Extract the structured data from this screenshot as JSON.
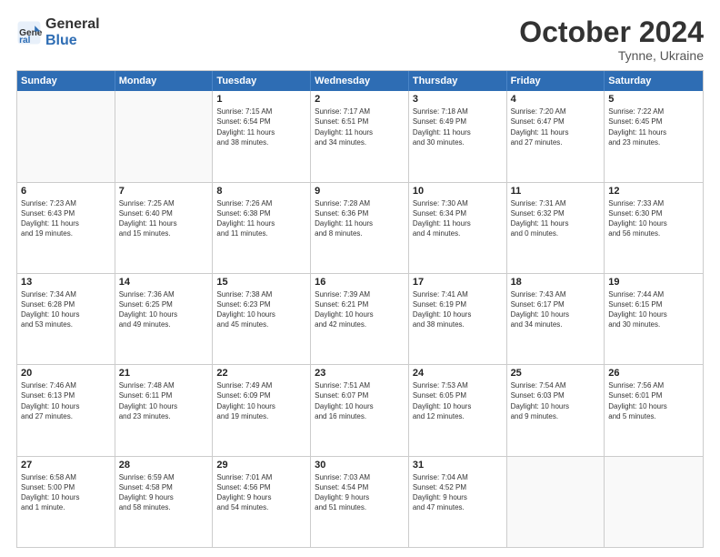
{
  "header": {
    "logo_general": "General",
    "logo_blue": "Blue",
    "month_title": "October 2024",
    "subtitle": "Tynne, Ukraine"
  },
  "weekdays": [
    "Sunday",
    "Monday",
    "Tuesday",
    "Wednesday",
    "Thursday",
    "Friday",
    "Saturday"
  ],
  "rows": [
    [
      {
        "day": "",
        "empty": true
      },
      {
        "day": "",
        "empty": true
      },
      {
        "day": "1",
        "lines": [
          "Sunrise: 7:15 AM",
          "Sunset: 6:54 PM",
          "Daylight: 11 hours",
          "and 38 minutes."
        ]
      },
      {
        "day": "2",
        "lines": [
          "Sunrise: 7:17 AM",
          "Sunset: 6:51 PM",
          "Daylight: 11 hours",
          "and 34 minutes."
        ]
      },
      {
        "day": "3",
        "lines": [
          "Sunrise: 7:18 AM",
          "Sunset: 6:49 PM",
          "Daylight: 11 hours",
          "and 30 minutes."
        ]
      },
      {
        "day": "4",
        "lines": [
          "Sunrise: 7:20 AM",
          "Sunset: 6:47 PM",
          "Daylight: 11 hours",
          "and 27 minutes."
        ]
      },
      {
        "day": "5",
        "lines": [
          "Sunrise: 7:22 AM",
          "Sunset: 6:45 PM",
          "Daylight: 11 hours",
          "and 23 minutes."
        ]
      }
    ],
    [
      {
        "day": "6",
        "lines": [
          "Sunrise: 7:23 AM",
          "Sunset: 6:43 PM",
          "Daylight: 11 hours",
          "and 19 minutes."
        ]
      },
      {
        "day": "7",
        "lines": [
          "Sunrise: 7:25 AM",
          "Sunset: 6:40 PM",
          "Daylight: 11 hours",
          "and 15 minutes."
        ]
      },
      {
        "day": "8",
        "lines": [
          "Sunrise: 7:26 AM",
          "Sunset: 6:38 PM",
          "Daylight: 11 hours",
          "and 11 minutes."
        ]
      },
      {
        "day": "9",
        "lines": [
          "Sunrise: 7:28 AM",
          "Sunset: 6:36 PM",
          "Daylight: 11 hours",
          "and 8 minutes."
        ]
      },
      {
        "day": "10",
        "lines": [
          "Sunrise: 7:30 AM",
          "Sunset: 6:34 PM",
          "Daylight: 11 hours",
          "and 4 minutes."
        ]
      },
      {
        "day": "11",
        "lines": [
          "Sunrise: 7:31 AM",
          "Sunset: 6:32 PM",
          "Daylight: 11 hours",
          "and 0 minutes."
        ]
      },
      {
        "day": "12",
        "lines": [
          "Sunrise: 7:33 AM",
          "Sunset: 6:30 PM",
          "Daylight: 10 hours",
          "and 56 minutes."
        ]
      }
    ],
    [
      {
        "day": "13",
        "lines": [
          "Sunrise: 7:34 AM",
          "Sunset: 6:28 PM",
          "Daylight: 10 hours",
          "and 53 minutes."
        ]
      },
      {
        "day": "14",
        "lines": [
          "Sunrise: 7:36 AM",
          "Sunset: 6:25 PM",
          "Daylight: 10 hours",
          "and 49 minutes."
        ]
      },
      {
        "day": "15",
        "lines": [
          "Sunrise: 7:38 AM",
          "Sunset: 6:23 PM",
          "Daylight: 10 hours",
          "and 45 minutes."
        ]
      },
      {
        "day": "16",
        "lines": [
          "Sunrise: 7:39 AM",
          "Sunset: 6:21 PM",
          "Daylight: 10 hours",
          "and 42 minutes."
        ]
      },
      {
        "day": "17",
        "lines": [
          "Sunrise: 7:41 AM",
          "Sunset: 6:19 PM",
          "Daylight: 10 hours",
          "and 38 minutes."
        ]
      },
      {
        "day": "18",
        "lines": [
          "Sunrise: 7:43 AM",
          "Sunset: 6:17 PM",
          "Daylight: 10 hours",
          "and 34 minutes."
        ]
      },
      {
        "day": "19",
        "lines": [
          "Sunrise: 7:44 AM",
          "Sunset: 6:15 PM",
          "Daylight: 10 hours",
          "and 30 minutes."
        ]
      }
    ],
    [
      {
        "day": "20",
        "lines": [
          "Sunrise: 7:46 AM",
          "Sunset: 6:13 PM",
          "Daylight: 10 hours",
          "and 27 minutes."
        ]
      },
      {
        "day": "21",
        "lines": [
          "Sunrise: 7:48 AM",
          "Sunset: 6:11 PM",
          "Daylight: 10 hours",
          "and 23 minutes."
        ]
      },
      {
        "day": "22",
        "lines": [
          "Sunrise: 7:49 AM",
          "Sunset: 6:09 PM",
          "Daylight: 10 hours",
          "and 19 minutes."
        ]
      },
      {
        "day": "23",
        "lines": [
          "Sunrise: 7:51 AM",
          "Sunset: 6:07 PM",
          "Daylight: 10 hours",
          "and 16 minutes."
        ]
      },
      {
        "day": "24",
        "lines": [
          "Sunrise: 7:53 AM",
          "Sunset: 6:05 PM",
          "Daylight: 10 hours",
          "and 12 minutes."
        ]
      },
      {
        "day": "25",
        "lines": [
          "Sunrise: 7:54 AM",
          "Sunset: 6:03 PM",
          "Daylight: 10 hours",
          "and 9 minutes."
        ]
      },
      {
        "day": "26",
        "lines": [
          "Sunrise: 7:56 AM",
          "Sunset: 6:01 PM",
          "Daylight: 10 hours",
          "and 5 minutes."
        ]
      }
    ],
    [
      {
        "day": "27",
        "lines": [
          "Sunrise: 6:58 AM",
          "Sunset: 5:00 PM",
          "Daylight: 10 hours",
          "and 1 minute."
        ]
      },
      {
        "day": "28",
        "lines": [
          "Sunrise: 6:59 AM",
          "Sunset: 4:58 PM",
          "Daylight: 9 hours",
          "and 58 minutes."
        ]
      },
      {
        "day": "29",
        "lines": [
          "Sunrise: 7:01 AM",
          "Sunset: 4:56 PM",
          "Daylight: 9 hours",
          "and 54 minutes."
        ]
      },
      {
        "day": "30",
        "lines": [
          "Sunrise: 7:03 AM",
          "Sunset: 4:54 PM",
          "Daylight: 9 hours",
          "and 51 minutes."
        ]
      },
      {
        "day": "31",
        "lines": [
          "Sunrise: 7:04 AM",
          "Sunset: 4:52 PM",
          "Daylight: 9 hours",
          "and 47 minutes."
        ]
      },
      {
        "day": "",
        "empty": true
      },
      {
        "day": "",
        "empty": true
      }
    ]
  ]
}
